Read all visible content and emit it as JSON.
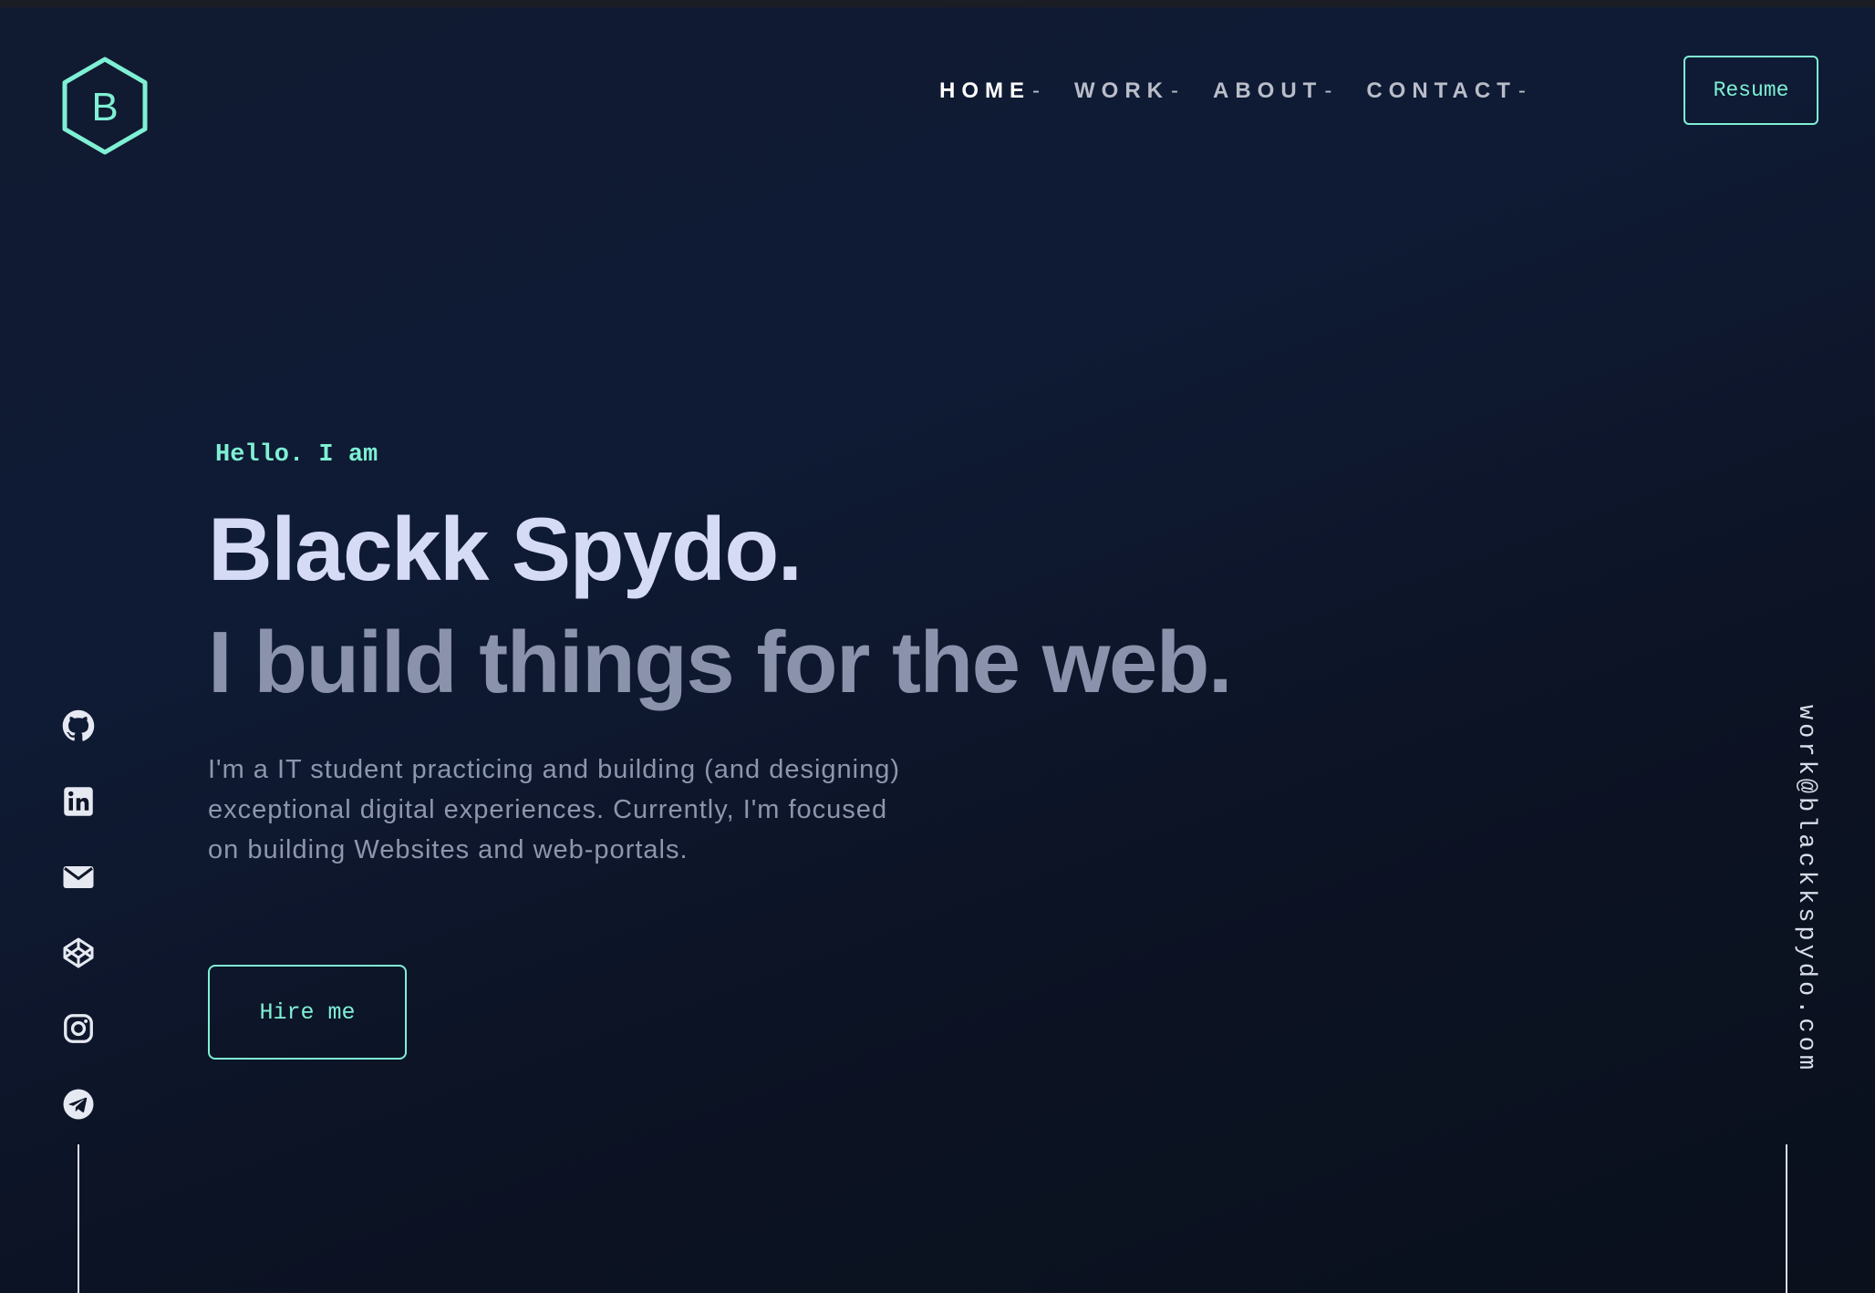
{
  "logo": {
    "letter": "B",
    "icon": "hexagon-logo-icon"
  },
  "nav": {
    "items": [
      {
        "label": "HOME",
        "suffix": "-",
        "active": true
      },
      {
        "label": "WORK",
        "suffix": "-",
        "active": false
      },
      {
        "label": "ABOUT",
        "suffix": "-",
        "active": false
      },
      {
        "label": "CONTACT",
        "suffix": "-",
        "active": false
      }
    ],
    "resume_label": "Resume"
  },
  "hero": {
    "greeting": "Hello. I am",
    "name": "Blackk Spydo.",
    "tagline": "I build things for the web.",
    "bio_lines": [
      "I'm a IT student practicing and building (and designing)",
      "exceptional digital experiences. Currently, I'm focused",
      "on building Websites and web-portals."
    ],
    "hire_label": "Hire me"
  },
  "socials": [
    {
      "icon": "github-icon"
    },
    {
      "icon": "linkedin-icon"
    },
    {
      "icon": "mail-icon"
    },
    {
      "icon": "codepen-icon"
    },
    {
      "icon": "instagram-icon"
    },
    {
      "icon": "telegram-icon"
    }
  ],
  "email": "work@blackkspydo.com",
  "colors": {
    "accent": "#7ff0d4",
    "name": "#d6dbf5",
    "tagline": "#8b92ab",
    "body_text": "#8e96ad",
    "nav_text": "#b9bdc9",
    "background": "#0f1b35"
  }
}
